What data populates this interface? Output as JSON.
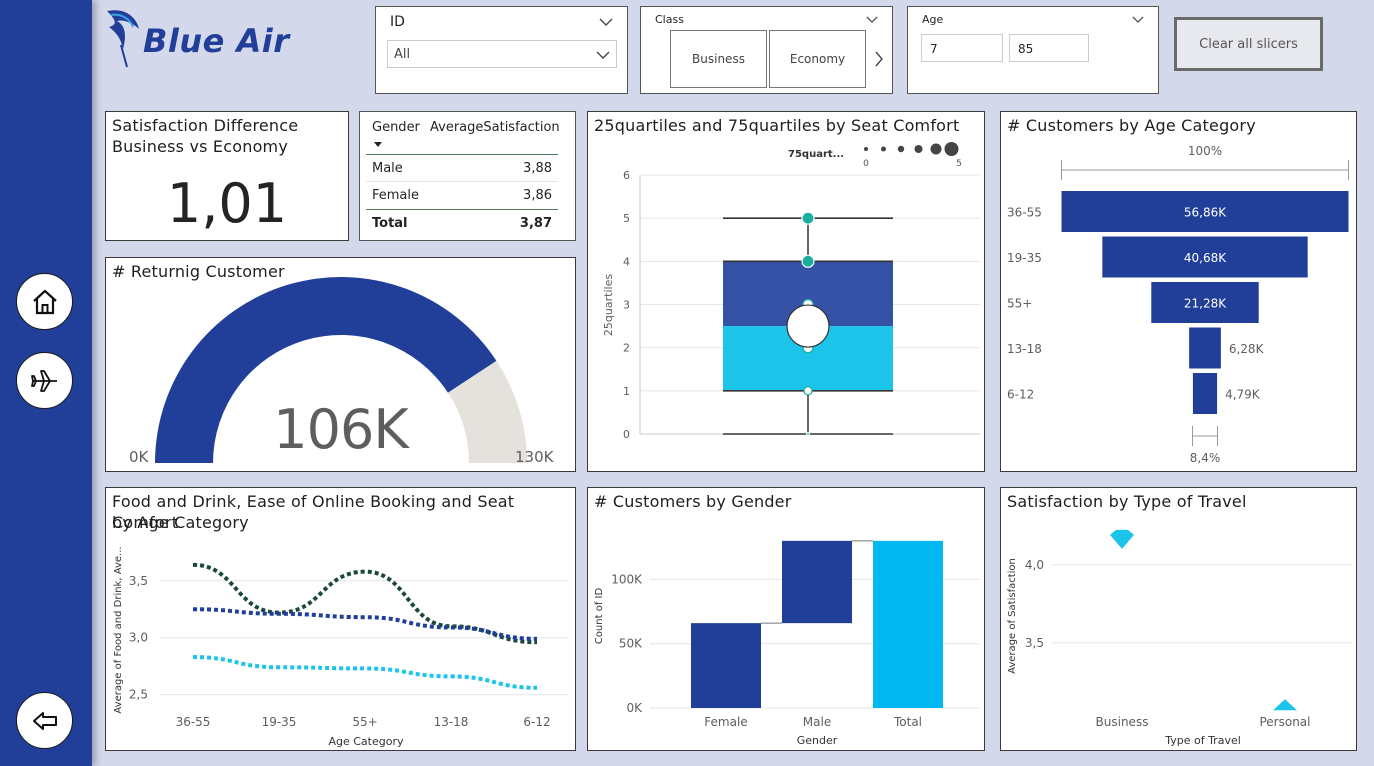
{
  "brand": {
    "name": "Blue Air"
  },
  "colors": {
    "dark_blue": "#213f99",
    "light_blue": "#1dc4ea",
    "cyan": "#01b8f0",
    "teal": "#1aae9f",
    "gray": "#e5e1dc",
    "dark_green": "#1a4a3a"
  },
  "nav": {
    "icons": [
      "home-icon",
      "airplane-icon",
      "back-arrow-icon"
    ]
  },
  "slicers": {
    "id": {
      "label": "ID",
      "value": "All"
    },
    "class": {
      "label": "Class",
      "options": [
        "Business",
        "Economy"
      ]
    },
    "age": {
      "label": "Age",
      "min": "7",
      "max": "85"
    },
    "clear": {
      "label": "Clear all slicers"
    }
  },
  "kpi": {
    "title_line1": "Satisfaction Difference",
    "title_line2": "Business vs Economy",
    "value": "1,01"
  },
  "gender_table": {
    "headers": [
      "Gender",
      "AverageSatisfaction"
    ],
    "rows": [
      {
        "gender": "Male",
        "avg": "3,88"
      },
      {
        "gender": "Female",
        "avg": "3,86"
      }
    ],
    "total": {
      "label": "Total",
      "avg": "3,87"
    }
  },
  "gauge": {
    "title": "# Returnig Customer",
    "value_label": "106K",
    "min_label": "0K",
    "max_label": "130K",
    "fraction": 0.815
  },
  "chart_data": [
    {
      "type": "boxplot",
      "title": "25quartiles and 75quartiles by Seat Comfort",
      "ylabel": "25quartiles",
      "legend_label": "75quart...",
      "legend_scale": [
        "0",
        "5"
      ],
      "yticks": [
        "0",
        "1",
        "2",
        "3",
        "4",
        "5",
        "6"
      ],
      "ylim": [
        0,
        6
      ],
      "min": 0,
      "q1": 1,
      "median": 2.5,
      "q3": 4,
      "max": 5,
      "points": [
        0,
        1,
        2,
        3,
        4,
        5
      ],
      "mean": 2.5
    },
    {
      "type": "funnel",
      "title": "# Customers by Age Category",
      "top_label": "100%",
      "bottom_label": "8,4%",
      "categories": [
        "36-55",
        "19-35",
        "55+",
        "13-18",
        "6-12"
      ],
      "values": [
        56.86,
        40.68,
        21.28,
        6.28,
        4.79
      ],
      "value_labels": [
        "56,86K",
        "40,68K",
        "21,28K",
        "6,28K",
        "4,79K"
      ]
    },
    {
      "type": "line",
      "title_line1": "Food and Drink, Ease of Online Booking and Seat Comfort",
      "title_line2": "by Age Category",
      "xlabel": "Age Category",
      "ylabel": "Average of Food and Drink, Ave...",
      "categories": [
        "36-55",
        "19-35",
        "55+",
        "13-18",
        "6-12"
      ],
      "yticks": [
        "2,5",
        "3,0",
        "3,5"
      ],
      "ylim": [
        2.4,
        3.7
      ],
      "series": [
        {
          "values": [
            3.64,
            3.22,
            3.58,
            3.1,
            2.96
          ]
        },
        {
          "values": [
            3.25,
            3.21,
            3.18,
            3.09,
            2.99
          ]
        },
        {
          "values": [
            2.83,
            2.74,
            2.73,
            2.66,
            2.56
          ]
        }
      ]
    },
    {
      "type": "waterfall",
      "title": "# Customers by Gender",
      "xlabel": "Gender",
      "ylabel": "Count of ID",
      "categories": [
        "Female",
        "Male",
        "Total"
      ],
      "increments": [
        66,
        64,
        130
      ],
      "yticks": [
        "0K",
        "50K",
        "100K"
      ],
      "ylim": [
        0,
        140
      ]
    },
    {
      "type": "scatter",
      "title": "Satisfaction by Type of Travel",
      "xlabel": "Type of Travel",
      "ylabel": "Average of Satisfaction",
      "categories": [
        "Business",
        "Personal"
      ],
      "values": [
        4.16,
        3.1
      ],
      "yticks": [
        "3,5",
        "4,0"
      ],
      "ylim": [
        3.05,
        4.3
      ]
    }
  ]
}
